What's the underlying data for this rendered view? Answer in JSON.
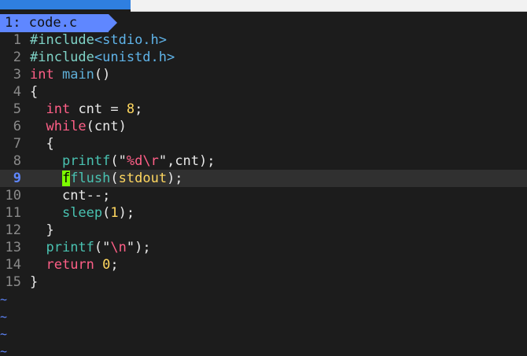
{
  "tabline": {
    "active_tab": "1: code.c"
  },
  "lines": [
    {
      "n": "1"
    },
    {
      "n": "2"
    },
    {
      "n": "3"
    },
    {
      "n": "4"
    },
    {
      "n": "5"
    },
    {
      "n": "6"
    },
    {
      "n": "7"
    },
    {
      "n": "8"
    },
    {
      "n": "9"
    },
    {
      "n": "10"
    },
    {
      "n": "11"
    },
    {
      "n": "12"
    },
    {
      "n": "13"
    },
    {
      "n": "14"
    },
    {
      "n": "15"
    }
  ],
  "code": {
    "l1": {
      "a": "#include",
      "b": "<stdio.h>"
    },
    "l2": {
      "a": "#include",
      "b": "<unistd.h>"
    },
    "l3": {
      "a": "int",
      "b": " ",
      "c": "main",
      "d": "()"
    },
    "l4": {
      "a": "{"
    },
    "l5": {
      "indent": "  ",
      "a": "int",
      "b": " cnt = ",
      "c": "8",
      "d": ";"
    },
    "l6": {
      "indent": "  ",
      "a": "while",
      "b": "(cnt)"
    },
    "l7": {
      "indent": "  ",
      "a": "{"
    },
    "l8": {
      "indent": "    ",
      "a": "printf",
      "b": "(\"",
      "c": "%d",
      "d": "\\r",
      "e": "\"",
      "f": ",cnt);"
    },
    "l9": {
      "indent": "    ",
      "cursor": "f",
      "a": "flush",
      "b": "(",
      "c": "stdout",
      "d": ");"
    },
    "l10": {
      "indent": "    ",
      "a": "cnt--;"
    },
    "l11": {
      "indent": "    ",
      "a": "sleep",
      "b": "(",
      "c": "1",
      "d": ");"
    },
    "l12": {
      "indent": "  ",
      "a": "}"
    },
    "l13": {
      "indent": "  ",
      "a": "printf",
      "b": "(\"",
      "c": "\\n",
      "d": "\");"
    },
    "l14": {
      "indent": "  ",
      "a": "return",
      "b": " ",
      "c": "0",
      "d": ";"
    },
    "l15": {
      "a": "}"
    }
  },
  "empty_marker": "~",
  "colors": {
    "background": "#1c1c1c",
    "tab_accent": "#5f87ff",
    "keyword": "#ff5f87",
    "number": "#ffd75f",
    "function": "#5fafd7",
    "preprocessor": "#7fd3c7",
    "cursor": "#7cfc00"
  }
}
